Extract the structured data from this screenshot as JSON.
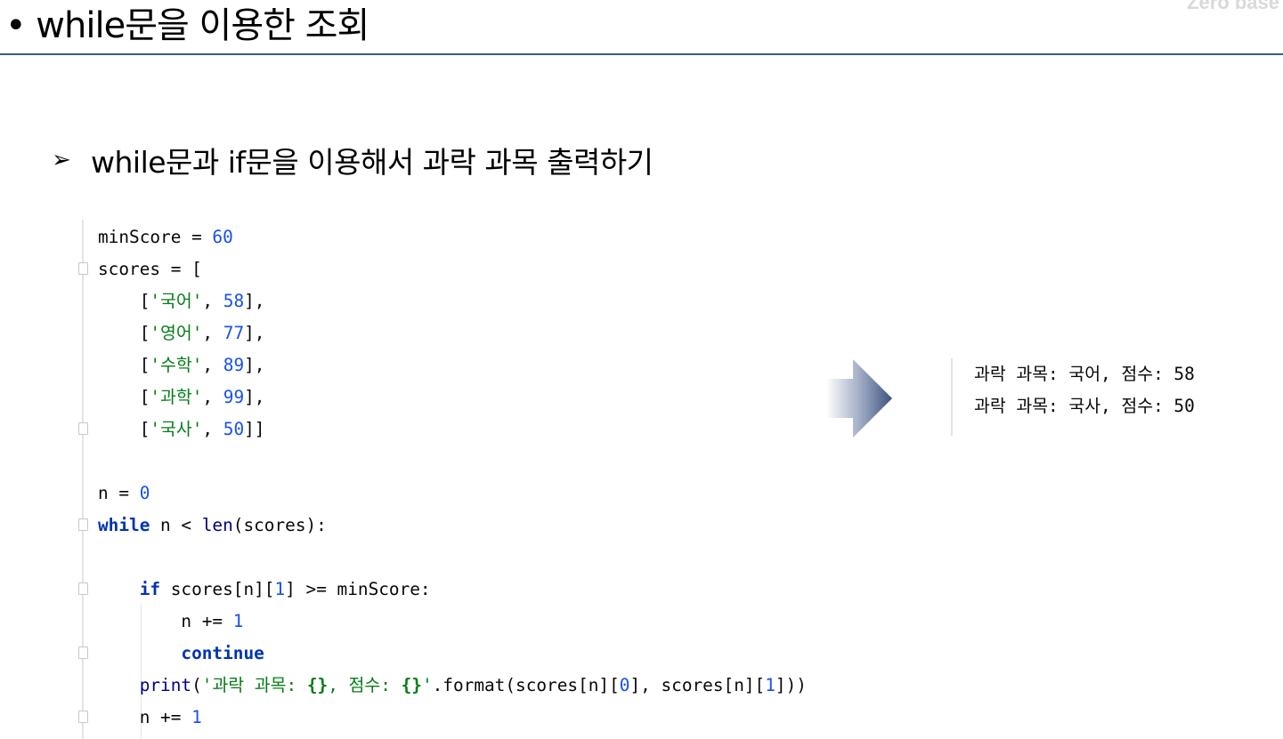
{
  "slide": {
    "title": "• while문을 이용한 조회",
    "corner_text": "Zero base",
    "subtitle_bullet": "➢",
    "subtitle": "while문과 if문을 이용해서 과락 과목 출력하기"
  },
  "code": {
    "language": "python",
    "lines": [
      "minScore = 60",
      "scores = [",
      "    ['국어', 58],",
      "    ['영어', 77],",
      "    ['수학', 89],",
      "    ['과학', 99],",
      "    ['국사', 50]]",
      "",
      "n = 0",
      "while n < len(scores):",
      "",
      "    if scores[n][1] >= minScore:",
      "        n += 1",
      "        continue",
      "    print('과락 과목: {}, 점수: {}'.format(scores[n][0], scores[n][1]))",
      "    n += 1"
    ]
  },
  "output": {
    "lines": [
      "과락 과목: 국어, 점수: 58",
      "과락 과목: 국사, 점수: 50"
    ]
  },
  "colors": {
    "keyword": "#0033b3",
    "number": "#1750eb",
    "string": "#067d17",
    "builtin": "#000080",
    "title_rule": "#3a5a8c",
    "arrow": "#3d5280"
  },
  "icons": {
    "subtitle_bullet": "arrowhead-bullet-icon",
    "flow_arrow": "right-arrow-icon",
    "fold_marker": "code-fold-icon"
  }
}
